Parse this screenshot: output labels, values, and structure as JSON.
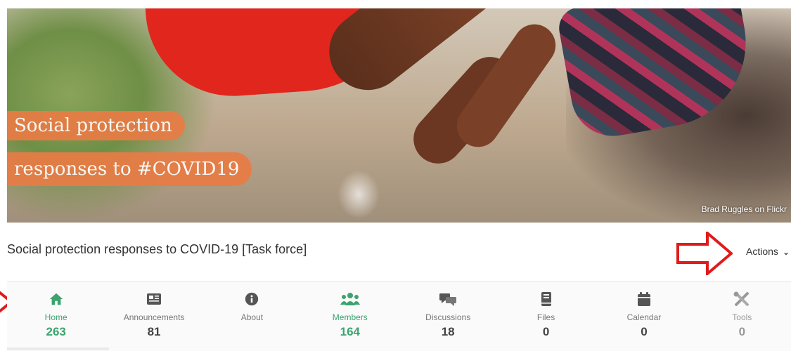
{
  "banner": {
    "title_line1": "Social protection",
    "title_line2": "responses to #COVID19",
    "photo_credit": "Brad Ruggles on Flickr",
    "accent_color": "#e87c45"
  },
  "group": {
    "title": "Social protection responses to COVID-19 [Task force]",
    "actions_label": "Actions"
  },
  "nav": {
    "active_color": "#3ca36f",
    "items": [
      {
        "label": "Home",
        "count": "263",
        "icon": "home-icon"
      },
      {
        "label": "Announcements",
        "count": "81",
        "icon": "newspaper-icon"
      },
      {
        "label": "About",
        "count": "",
        "icon": "info-icon"
      },
      {
        "label": "Members",
        "count": "164",
        "icon": "users-icon"
      },
      {
        "label": "Discussions",
        "count": "18",
        "icon": "comments-icon"
      },
      {
        "label": "Files",
        "count": "0",
        "icon": "book-icon"
      },
      {
        "label": "Calendar",
        "count": "0",
        "icon": "calendar-icon"
      },
      {
        "label": "Tools",
        "count": "0",
        "icon": "tools-icon"
      }
    ]
  }
}
